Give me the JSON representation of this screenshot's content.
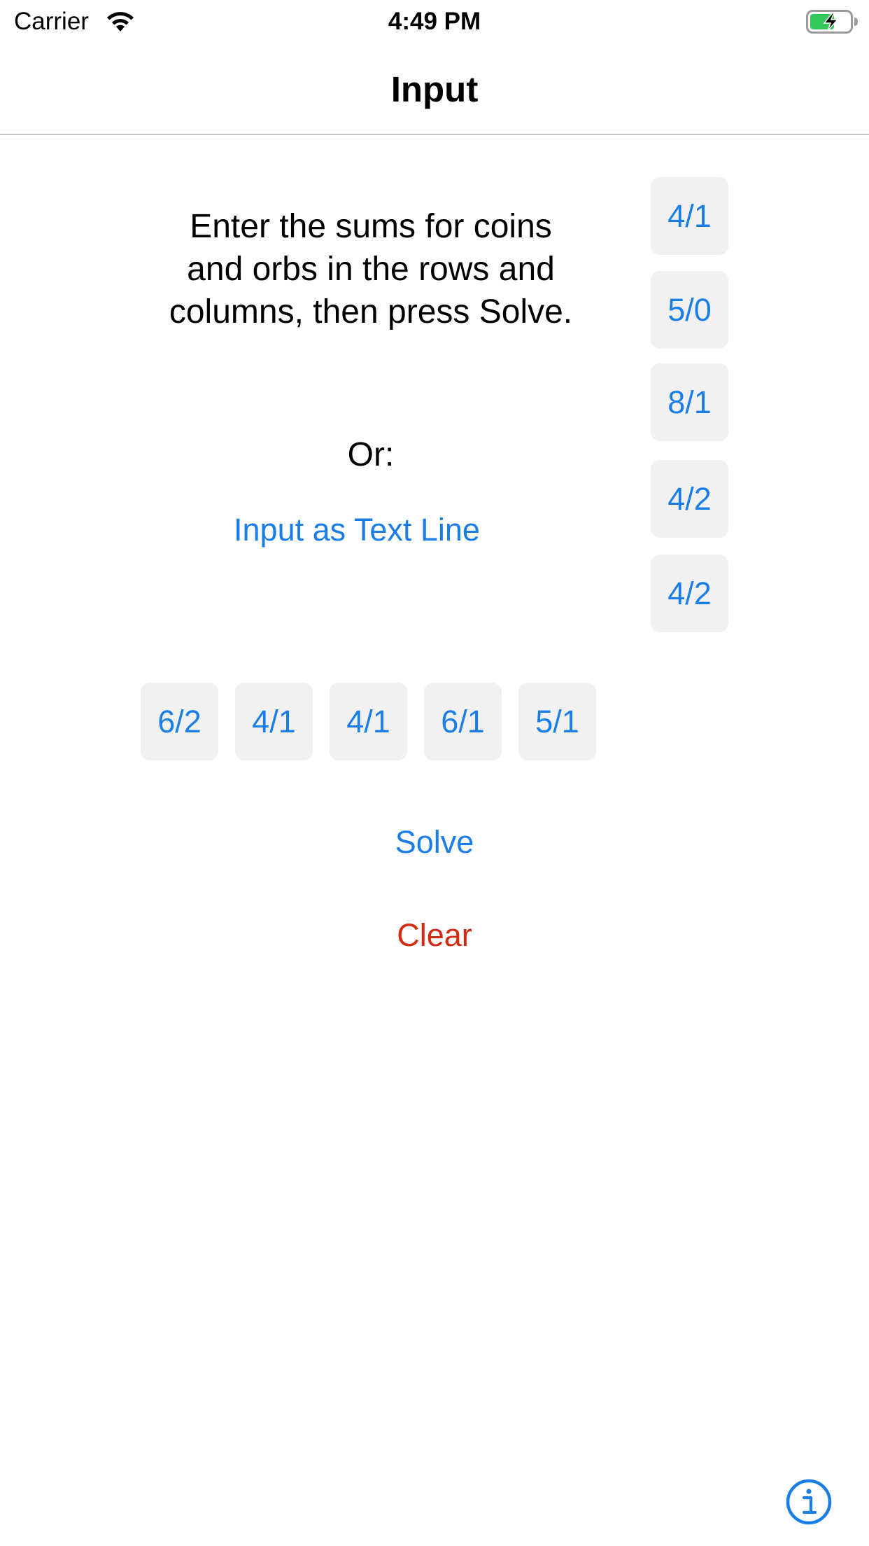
{
  "status_bar": {
    "carrier": "Carrier",
    "time": "4:49 PM",
    "wifi_icon": "wifi-icon",
    "battery_icon": "battery-charging-icon"
  },
  "nav": {
    "title": "Input"
  },
  "instructions": "Enter the sums for coins and orbs in the rows and columns, then press Solve.",
  "or_label": "Or:",
  "text_input_link": "Input as Text Line",
  "row_sums": [
    "4/1",
    "5/0",
    "8/1",
    "4/2",
    "4/2"
  ],
  "column_sums": [
    "6/2",
    "4/1",
    "4/1",
    "6/1",
    "5/1"
  ],
  "actions": {
    "solve": "Solve",
    "clear": "Clear"
  },
  "info_icon": "info-icon",
  "colors": {
    "accent": "#1a7ee6",
    "destructive": "#d12c12",
    "tile_background": "#f1f1f2",
    "battery_charge": "#34c759"
  }
}
